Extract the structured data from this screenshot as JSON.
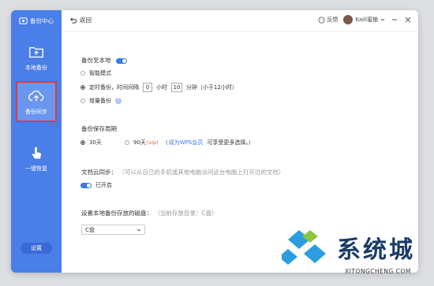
{
  "sidebar": {
    "brand": "备份中心",
    "items": [
      {
        "label": "本地备份",
        "icon": "folder-icon"
      },
      {
        "label": "备份同步",
        "icon": "cloud-upload-icon",
        "active": true
      },
      {
        "label": "一键恢复",
        "icon": "touch-hand-icon"
      }
    ],
    "settings": "设置"
  },
  "topbar": {
    "back": "返回",
    "feedback": "反馈",
    "user": "Kaili蜜柚"
  },
  "backup_local": {
    "title": "备份至本地",
    "enabled": true,
    "options": [
      {
        "label": "智能模式",
        "selected": false
      },
      {
        "label_prefix": "定时备份，时间间隔",
        "hours": "0",
        "hours_unit": "小时",
        "minutes": "10",
        "minutes_unit": "分钟（小于12小时）",
        "selected": true
      },
      {
        "label": "增量备份",
        "selected": false
      }
    ]
  },
  "retention": {
    "title": "备份保存周期",
    "options": [
      {
        "label": "30天",
        "selected": true
      },
      {
        "label": "90天",
        "badge": "(vip)",
        "selected": false
      }
    ],
    "link": "成为WPS会员",
    "tail": "可享受更多选择。）",
    "open_paren": "（"
  },
  "cloud_sync": {
    "title": "文档云同步：",
    "hint": "（可以从自己的手机或其他电脑访问这台电脑上打开过的文档）",
    "status": "已开启",
    "enabled": true
  },
  "disk": {
    "title": "设置本地备份存放的磁盘：",
    "hint": "（当前存放目录：C盘）",
    "selected": "C盘"
  },
  "watermark": {
    "brand": "系统城",
    "domain": "XITONGCHENG.COM"
  },
  "colors": {
    "sidebar": "#4a7ee8",
    "accent": "#3a78e8",
    "active_border": "#e43a32"
  }
}
